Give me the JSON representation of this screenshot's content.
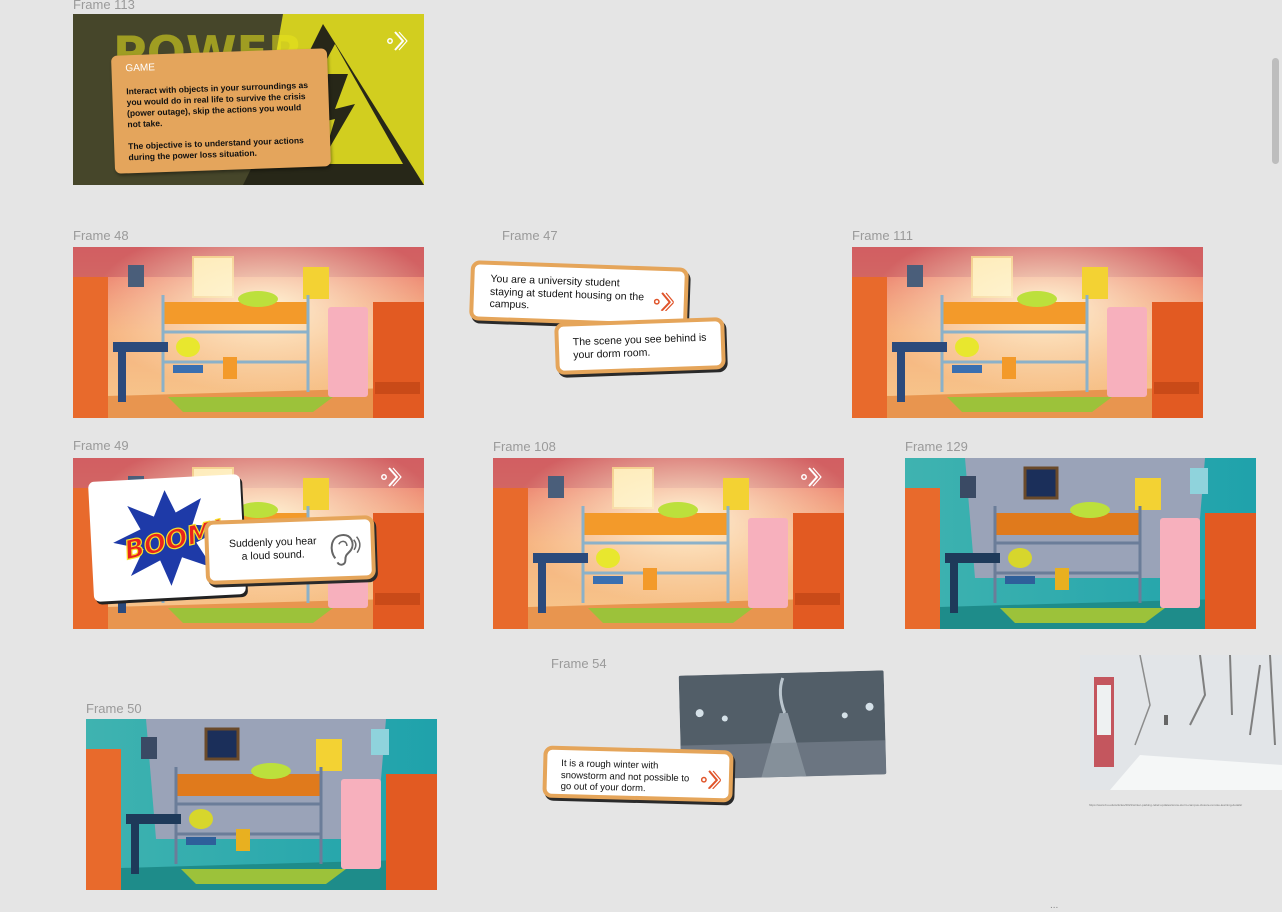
{
  "frames": {
    "f113": {
      "label": "Frame 113"
    },
    "f48": {
      "label": "Frame 48"
    },
    "f47": {
      "label": "Frame 47"
    },
    "f111": {
      "label": "Frame 111"
    },
    "f49": {
      "label": "Frame 49"
    },
    "f108": {
      "label": "Frame 108"
    },
    "f129": {
      "label": "Frame 129"
    },
    "f50": {
      "label": "Frame 50"
    },
    "f54": {
      "label": "Frame 54"
    }
  },
  "game_card": {
    "heading": "GAME",
    "line1": "Interact with objects in your surroundings as you would do in real life to survive the crisis (power outage), skip the actions you would not take.",
    "line2": "The objective is to understand your actions during the power loss situation."
  },
  "backdrop_text": "POWER",
  "story": {
    "card1": "You are a university student staying at student housing on the campus.",
    "card2": "The scene you see behind is your dorm room.",
    "boom": "BOOM!",
    "sound": "Suddenly you hear a  loud sound.",
    "winter": "It is a rough winter with snowstorm and not possible to go out of your dorm."
  },
  "reference": {
    "url": "https://www.bu.edu/articles/2021/winter-parking-relief-updates/snow-storm-campus-closure-remote-learning-details/"
  },
  "canvas_more": "...",
  "icons": [
    "next-arrow-icon",
    "ear-icon"
  ],
  "colors": {
    "card_border": "#e5a55a",
    "canvas_bg": "#e5e5e5",
    "warm_room": "#f4a070",
    "teal_room": "#20a8a8"
  }
}
